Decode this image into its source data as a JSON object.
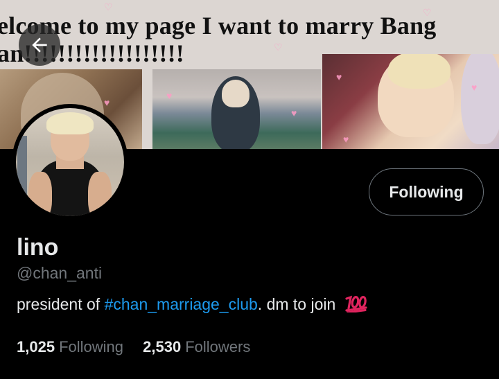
{
  "banner": {
    "line1": "elcome to my page I want to marry Bang",
    "line2": "an!!!!!!!!!!!!!!!!!!!"
  },
  "header": {
    "back_icon": "arrow-left-icon"
  },
  "profile": {
    "display_name": "lino",
    "handle": "@chan_anti",
    "bio_prefix": "president of ",
    "bio_hashtag": "#chan_marriage_club",
    "bio_suffix": ". dm to join",
    "bio_emoji": "hundred-points-emoji",
    "follow_button_label": "Following"
  },
  "stats": {
    "following_count": "1,025",
    "following_label": "Following",
    "followers_count": "2,530",
    "followers_label": "Followers"
  },
  "colors": {
    "background": "#000000",
    "text_primary": "#e7e9ea",
    "text_secondary": "#71767b",
    "link": "#1d9bf0",
    "button_border": "#6e767d"
  }
}
